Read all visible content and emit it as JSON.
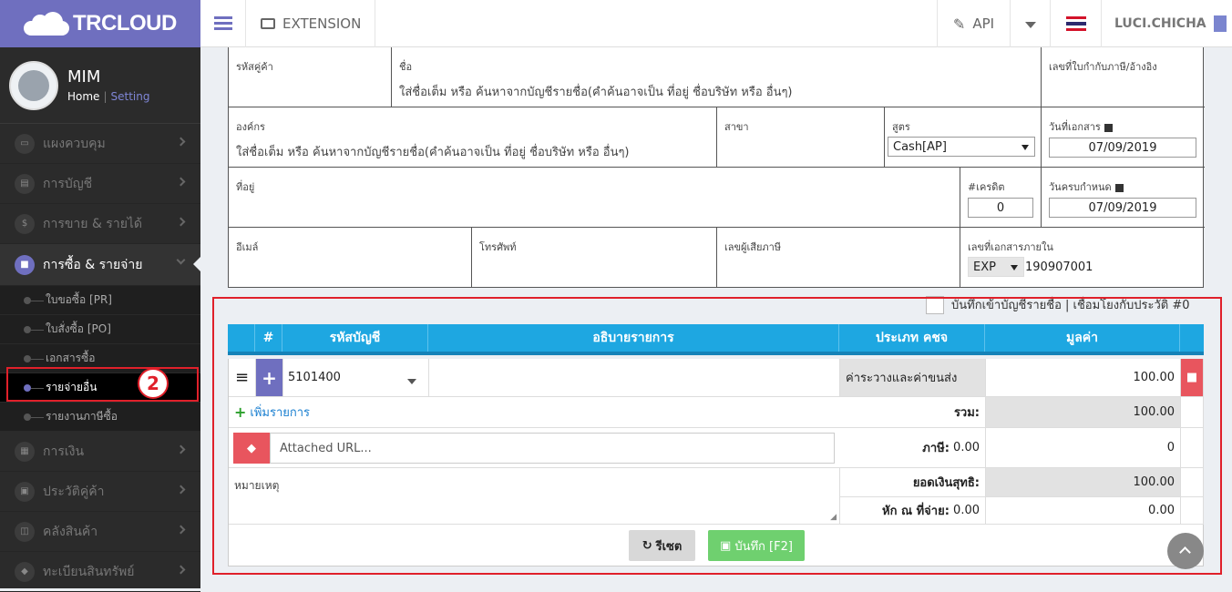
{
  "brand": {
    "logo_text": "TRCLOUD"
  },
  "user": {
    "name": "MIM",
    "home": "Home",
    "sep": "|",
    "setting": "Setting"
  },
  "menu": [
    {
      "label": "แผงควบคุม",
      "icon": "monitor-icon"
    },
    {
      "label": "การบัญชี",
      "icon": "book-icon"
    },
    {
      "label": "การขาย & รายได้",
      "icon": "dollar-icon"
    },
    {
      "label": "การซื้อ & รายจ่าย",
      "icon": "cart-icon"
    },
    {
      "label": "การเงิน",
      "icon": "calendar-icon"
    },
    {
      "label": "ประวัติคู่ค้า",
      "icon": "contact-icon"
    },
    {
      "label": "คลังสินค้า",
      "icon": "boxes-icon"
    },
    {
      "label": "ทะเบียนสินทรัพย์",
      "icon": "diamond-icon"
    }
  ],
  "submenu": [
    {
      "label": "ใบขอซื้อ [PR]"
    },
    {
      "label": "ใบสั่งซื้อ [PO]"
    },
    {
      "label": "เอกสารซื้อ"
    },
    {
      "label": "รายจ่ายอื่น"
    },
    {
      "label": "รายงานภาษีซื้อ"
    }
  ],
  "annotation": {
    "badge": "2"
  },
  "header": {
    "extension": "EXTENSION",
    "api": "API",
    "username": "LUCI.CHICHA"
  },
  "form": {
    "customer_code_label": "รหัสคู่ค้า",
    "name_label": "ชื่อ",
    "name_placeholder": "ใส่ชื่อเต็ม หรือ ค้นหาจากบัญชีรายชื่อ(คำค้นอาจเป็น ที่อยู่ ชื่อบริษัท หรือ อื่นๆ)",
    "tax_ref_label": "เลขที่ใบกำกับภาษี/อ้างอิง",
    "org_label": "องค์กร",
    "org_placeholder": "ใส่ชื่อเต็ม หรือ ค้นหาจากบัญชีรายชื่อ(คำค้นอาจเป็น ที่อยู่ ชื่อบริษัท หรือ อื่นๆ)",
    "branch_label": "สาขา",
    "formula_label": "สูตร",
    "formula_value": "Cash[AP]",
    "doc_date_label": "วันที่เอกสาร",
    "doc_date": "07/09/2019",
    "address_label": "ที่อยู่",
    "credit_label": "#เครดิต",
    "credit_value": "0",
    "due_date_label": "วันครบกำหนด",
    "due_date": "07/09/2019",
    "email_label": "อีเมล์",
    "phone_label": "โทรศัพท์",
    "taxid_label": "เลขผู้เสียภาษี",
    "internal_doc_label": "เลขที่เอกสารภายใน",
    "doc_prefix": "EXP",
    "doc_number": "190907001"
  },
  "checkbox": {
    "label": "บันทึกเข้าบัญชีรายชื่อ | เชื่อมโยงกับประวัติ #0"
  },
  "table": {
    "headers": [
      "#",
      "รหัสบัญชี",
      "อธิบายรายการ",
      "ประเภท คชจ",
      "มูลค่า"
    ],
    "row": {
      "account": "5101400",
      "description": "",
      "type": "ค่าระวางและค่าขนส่ง",
      "amount": "100.00"
    }
  },
  "add_item": "เพิ่มรายการ",
  "totals": {
    "sum_label": "รวม:",
    "sum_value": "100.00",
    "vat_label": "ภาษี:",
    "vat_rate": "0.00",
    "vat_value": "0",
    "net_label": "ยอดเงินสุทธิ:",
    "net_value": "100.00",
    "wht_label": "หัก ณ ที่จ่าย:",
    "wht_rate": "0.00",
    "wht_value": "0.00"
  },
  "attach": {
    "placeholder": "Attached URL..."
  },
  "remark_label": "หมายเหตุ",
  "buttons": {
    "reset": "รีเซต",
    "save": "บันทึก [F2]"
  },
  "colors": {
    "brand": "#6f6fbf",
    "table_header": "#1ea7e1",
    "save_button": "#6fd06f",
    "delete_button": "#e8555e",
    "highlight": "#e0202a"
  }
}
